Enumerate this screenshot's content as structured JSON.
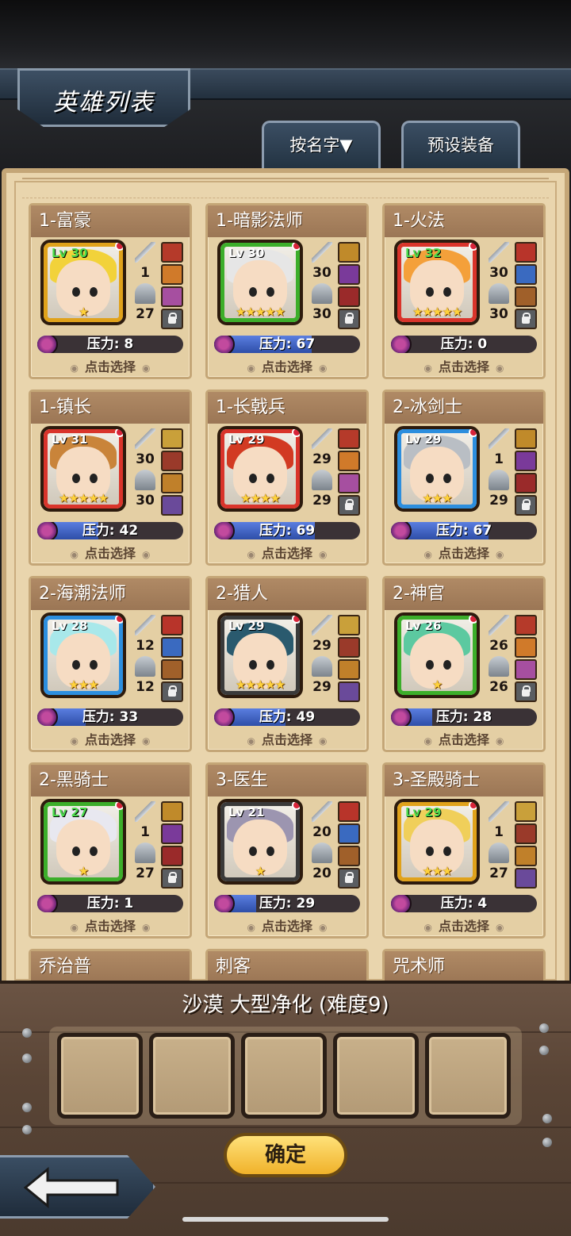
{
  "header": {
    "title": "英雄列表"
  },
  "tabs": {
    "sort_label": "按名字▼",
    "preset_label": "预设装备"
  },
  "heroes": [
    {
      "name": "1-富豪",
      "level": "Lv 30",
      "lv_green": true,
      "attack": "1",
      "defense": "27",
      "pressure": "压力: 8",
      "pressure_value": 8,
      "stars": "★",
      "select": "点击选择",
      "frame": "#e0a21b",
      "hair": "#f2d23a"
    },
    {
      "name": "1-暗影法师",
      "level": "Lv 30",
      "lv_green": false,
      "attack": "30",
      "defense": "30",
      "pressure": "压力: 67",
      "pressure_value": 67,
      "stars": "★★★★★",
      "select": "点击选择",
      "frame": "#3cae2a",
      "hair": "#e6e6e6"
    },
    {
      "name": "1-火法",
      "level": "Lv 32",
      "lv_green": true,
      "attack": "30",
      "defense": "30",
      "pressure": "压力: 0",
      "pressure_value": 0,
      "stars": "★★★★★",
      "select": "点击选择",
      "frame": "#d9342b",
      "hair": "#f4a03a"
    },
    {
      "name": "1-镇长",
      "level": "Lv 31",
      "lv_green": false,
      "attack": "30",
      "defense": "30",
      "pressure": "压力: 42",
      "pressure_value": 42,
      "stars": "★★★★★",
      "select": "点击选择",
      "frame": "#d9342b",
      "hair": "#c9843a"
    },
    {
      "name": "1-长戟兵",
      "level": "Lv 29",
      "lv_green": false,
      "attack": "29",
      "defense": "29",
      "pressure": "压力: 69",
      "pressure_value": 69,
      "stars": "★★★★",
      "select": "点击选择",
      "frame": "#d9342b",
      "hair": "#d23a22"
    },
    {
      "name": "2-冰剑士",
      "level": "Lv 29",
      "lv_green": false,
      "attack": "1",
      "defense": "29",
      "pressure": "压力: 67",
      "pressure_value": 67,
      "stars": "★★★",
      "select": "点击选择",
      "frame": "#2c8ede",
      "hair": "#b9bec4"
    },
    {
      "name": "2-海潮法师",
      "level": "Lv 28",
      "lv_green": false,
      "attack": "12",
      "defense": "12",
      "pressure": "压力: 33",
      "pressure_value": 33,
      "stars": "★★★",
      "select": "点击选择",
      "frame": "#2c8ede",
      "hair": "#a8e8ea"
    },
    {
      "name": "2-猎人",
      "level": "Lv 29",
      "lv_green": false,
      "attack": "29",
      "defense": "29",
      "pressure": "压力: 49",
      "pressure_value": 49,
      "stars": "★★★★★",
      "select": "点击选择",
      "frame": "#3a3a3a",
      "hair": "#2a5a6e"
    },
    {
      "name": "2-神官",
      "level": "Lv 26",
      "lv_green": false,
      "attack": "26",
      "defense": "26",
      "pressure": "压力: 28",
      "pressure_value": 28,
      "stars": "★",
      "select": "点击选择",
      "frame": "#3cae2a",
      "hair": "#5cc9a0"
    },
    {
      "name": "2-黑骑士",
      "level": "Lv 27",
      "lv_green": true,
      "attack": "1",
      "defense": "27",
      "pressure": "压力: 1",
      "pressure_value": 1,
      "stars": "★",
      "select": "点击选择",
      "frame": "#3cae2a",
      "hair": "#e8e8f0"
    },
    {
      "name": "3-医生",
      "level": "Lv 21",
      "lv_green": false,
      "attack": "20",
      "defense": "20",
      "pressure": "压力: 29",
      "pressure_value": 29,
      "stars": "★",
      "select": "点击选择",
      "frame": "#3a3a3a",
      "hair": "#9c95b0"
    },
    {
      "name": "3-圣殿骑士",
      "level": "Lv 29",
      "lv_green": true,
      "attack": "1",
      "defense": "27",
      "pressure": "压力: 4",
      "pressure_value": 4,
      "stars": "★★★",
      "select": "点击选择",
      "frame": "#e0a21b",
      "hair": "#f0cf5a"
    }
  ],
  "partial_heroes": [
    "乔治普",
    "刺客",
    "咒术师"
  ],
  "stage": {
    "title": "沙漠 大型净化 (难度9)"
  },
  "team_slots": 5,
  "confirm_label": "确定"
}
